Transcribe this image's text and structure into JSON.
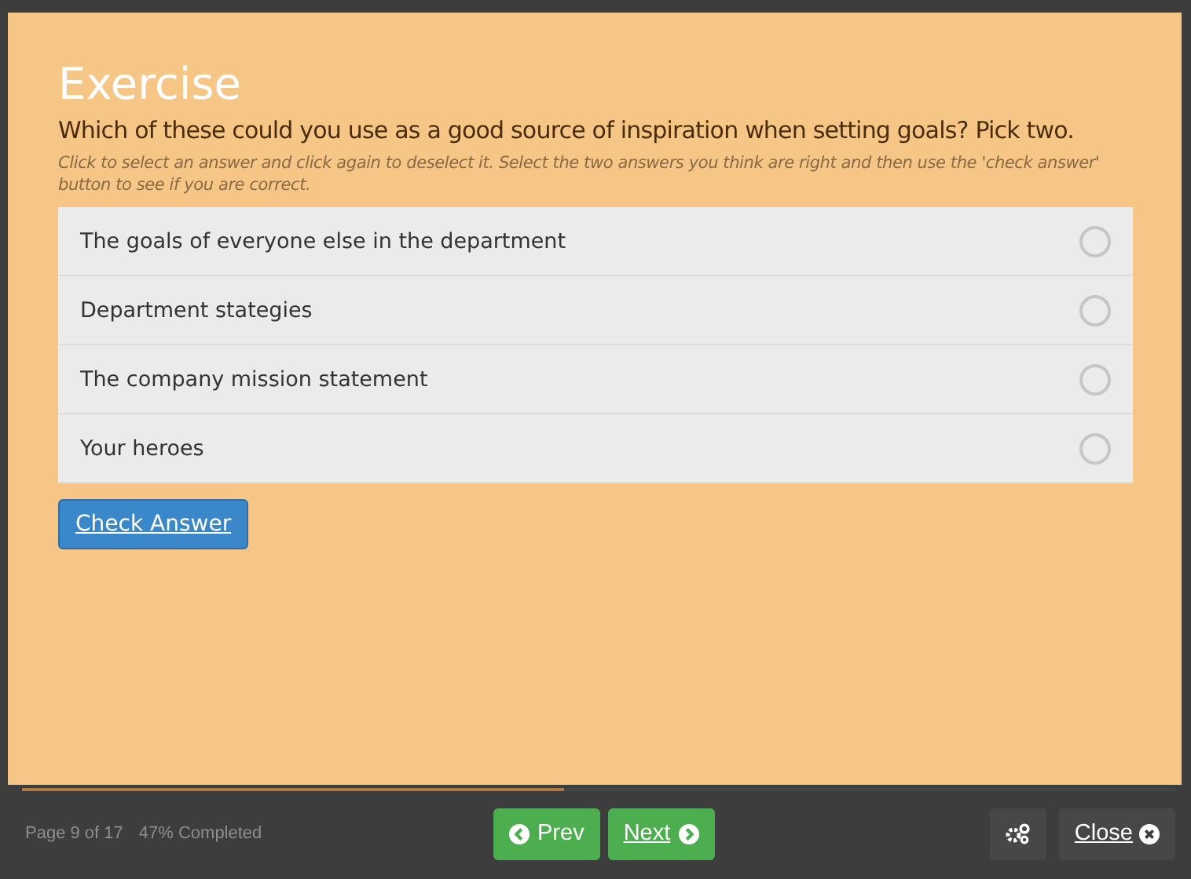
{
  "title": "Exercise",
  "question": "Which of these could you use as a good source of inspiration when setting goals? Pick two.",
  "instructions": "Click to select an answer and click again to deselect it. Select the two answers you think are right and then use the 'check answer' button to see if you are correct.",
  "answers": [
    {
      "label": "The goals of everyone else in the department",
      "selected": false
    },
    {
      "label": "Department stategies",
      "selected": false
    },
    {
      "label": "The company mission statement",
      "selected": false
    },
    {
      "label": "Your heroes",
      "selected": false
    }
  ],
  "check_button": "Check Answer",
  "footer": {
    "progress": {
      "level": 0.47
    },
    "page": "Page 9 of 17",
    "completed": "47% Completed",
    "prev": "Prev",
    "next": "Next",
    "close": "Close"
  }
}
